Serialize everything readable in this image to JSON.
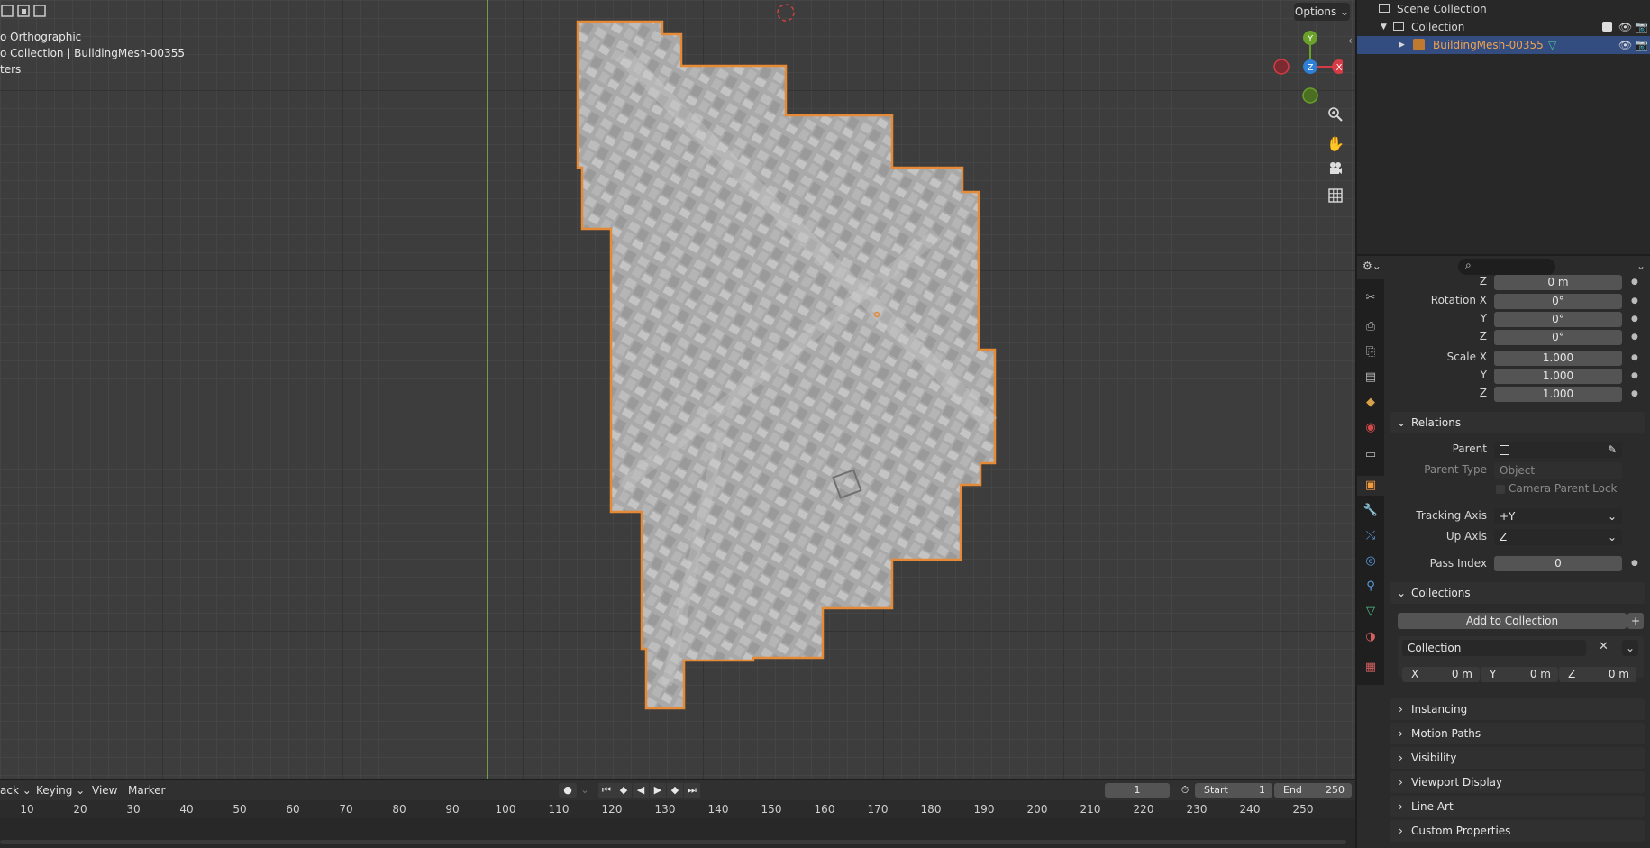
{
  "viewport": {
    "overlay_lines": [
      "o Orthographic",
      "o Collection | BuildingMesh-00355",
      "ters"
    ],
    "options_label": "Options",
    "gizmo_axes": {
      "y": "Y",
      "x": "X",
      "z": "Z"
    },
    "tools": [
      "zoom-icon",
      "hand-icon",
      "camera-icon",
      "grid-icon"
    ],
    "colors": {
      "selection": "#e58a36",
      "axis_y": "#6f9f3f",
      "gizmo_x": "#d63b46",
      "gizmo_y": "#6aa12b",
      "gizmo_z": "#2e7fd6"
    }
  },
  "outliner": {
    "root": "Scene Collection",
    "collection": "Collection",
    "object": "BuildingMesh-00355"
  },
  "properties": {
    "location_z_label": "Z",
    "location_z": "0 m",
    "rotation": {
      "label_x": "Rotation X",
      "label_y": "Y",
      "label_z": "Z",
      "x": "0°",
      "y": "0°",
      "z": "0°"
    },
    "scale": {
      "label_x": "Scale X",
      "label_y": "Y",
      "label_z": "Z",
      "x": "1.000",
      "y": "1.000",
      "z": "1.000"
    },
    "relations": {
      "header": "Relations",
      "parent_label": "Parent",
      "parent_type_label": "Parent Type",
      "parent_type_value": "Object",
      "camera_parent_lock": "Camera Parent Lock",
      "tracking_axis_label": "Tracking Axis",
      "tracking_axis_value": "+Y",
      "up_axis_label": "Up Axis",
      "up_axis_value": "Z",
      "pass_index_label": "Pass Index",
      "pass_index_value": "0"
    },
    "collections": {
      "header": "Collections",
      "add_label": "Add to Collection",
      "name": "Collection",
      "offset": {
        "x_label": "X",
        "x": "0 m",
        "y_label": "Y",
        "y": "0 m",
        "z_label": "Z",
        "z": "0 m"
      }
    },
    "collapsed_panels": [
      "Instancing",
      "Motion Paths",
      "Visibility",
      "Viewport Display",
      "Line Art",
      "Custom Properties"
    ]
  },
  "timeline": {
    "menus": {
      "playback": "ack",
      "keying": "Keying",
      "view": "View",
      "marker": "Marker"
    },
    "current_frame": "1",
    "start_label": "Start",
    "start_value": "1",
    "end_label": "End",
    "end_value": "250",
    "ticks": [
      "10",
      "20",
      "30",
      "40",
      "50",
      "60",
      "70",
      "80",
      "90",
      "100",
      "110",
      "120",
      "130",
      "140",
      "150",
      "160",
      "170",
      "180",
      "190",
      "200",
      "210",
      "220",
      "230",
      "240",
      "250"
    ]
  }
}
